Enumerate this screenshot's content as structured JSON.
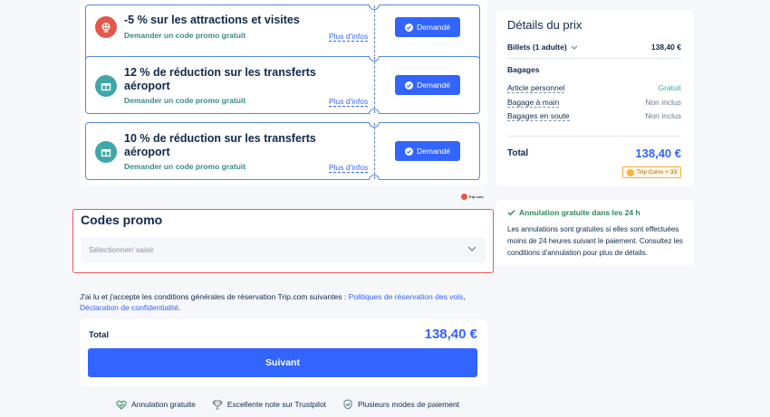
{
  "coupons": [
    {
      "title": "-5 % sur les attractions et visites",
      "subtitle": "Demander un code promo gratuit",
      "more": "Plus d'infos",
      "button": "Demandé",
      "icon": "attraction-icon",
      "color": "red"
    },
    {
      "title": "12 % de réduction sur les transferts aéroport",
      "subtitle": "Demander un code promo gratuit",
      "more": "Plus d'infos",
      "button": "Demandé",
      "icon": "gift-icon",
      "color": "teal"
    },
    {
      "title": "10 % de réduction sur les transferts aéroport",
      "subtitle": "Demander un code promo gratuit",
      "more": "Plus d'infos",
      "button": "Demandé",
      "icon": "gift-icon",
      "color": "teal"
    }
  ],
  "logo_text": "Trip.com",
  "promo": {
    "title": "Codes promo",
    "placeholder": "Sélectionner/ saisir"
  },
  "terms": {
    "text": "J'ai lu et j'accepte les conditions générales de réservation Trip.com suivantes :",
    "link1": "Politiques de réservation des vols",
    "link2": "Déclaration de confidentialité",
    "end": "."
  },
  "total": {
    "label": "Total",
    "amount": "138,40 €",
    "button": "Suivant"
  },
  "features": [
    {
      "label": "Annulation gratuite",
      "icon": "heart-check-icon"
    },
    {
      "label": "Excellente note sur Trustpilot",
      "icon": "trophy-icon"
    },
    {
      "label": "Plusieurs modes de paiement",
      "icon": "shield-check-icon"
    }
  ],
  "price_details": {
    "title": "Détails du prix",
    "tickets_label": "Billets (1 adulte)",
    "tickets_amount": "138,40 €",
    "baggage_title": "Bagages",
    "baggage": [
      {
        "label": "Article personnel",
        "value": "Gratuit"
      },
      {
        "label": "Bagage à main",
        "value": "Non inclus"
      },
      {
        "label": "Bagages en soute",
        "value": "Non inclus"
      }
    ],
    "total_label": "Total",
    "total_amount": "138,40 €",
    "coins": "Trip Coins + 33"
  },
  "cancellation": {
    "title": "Annulation gratuite dans les 24 h",
    "body": "Les annulations sont gratuites si elles sont effectuées moins de 24 heures suivant le paiement. Consultez les conditions d'annulation pour plus de détails."
  },
  "colors": {
    "accent": "#3264ff",
    "danger_border": "#e85c5c",
    "teal": "#3fa7a7"
  }
}
